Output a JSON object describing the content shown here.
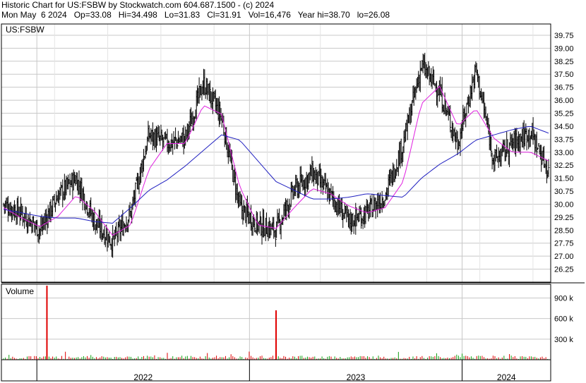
{
  "header": {
    "line1": "Historic Chart for US:FSBW by Stockwatch.com 604.687.1500 - (c) 2024",
    "line2": "Mon May  6 2024   Op=33.08   Hi=34.498   Lo=31.83   Cl=31.91   Vol=16,476   Year hi=38.70   lo=26.08"
  },
  "colors": {
    "price_bars": "#000000",
    "ma_short": "#e020e0",
    "ma_long": "#2020c0",
    "vol_up": "#10a010",
    "vol_down": "#e00000",
    "grid": "#c8c8c8"
  },
  "chart_data": [
    {
      "type": "line",
      "label": "US:FSBW",
      "series_style": "ohlc-bars with two moving averages",
      "y_ticks": [
        "39.75",
        "39.00",
        "38.25",
        "37.50",
        "36.75",
        "36.00",
        "35.25",
        "34.50",
        "33.75",
        "33.00",
        "32.25",
        "31.50",
        "30.75",
        "30.00",
        "29.25",
        "28.50",
        "27.75",
        "27.00",
        "26.25"
      ],
      "ylim": [
        25.5,
        40.4
      ],
      "x_ticks": [
        "2022",
        "2023",
        "2024"
      ],
      "grid": true,
      "series": [
        {
          "name": "",
          "kind": "price",
          "x": [
            "2021-11",
            "2021-12",
            "2022-01",
            "2022-02",
            "2022-03",
            "2022-04",
            "2022-05",
            "2022-06",
            "2022-07",
            "2022-08",
            "2022-09",
            "2022-10",
            "2022-11",
            "2022-12",
            "2023-01",
            "2023-02",
            "2023-03",
            "2023-04",
            "2023-05",
            "2023-06",
            "2023-07",
            "2023-08",
            "2023-09",
            "2023-10",
            "2023-11",
            "2023-12",
            "2024-01",
            "2024-02",
            "2024-03",
            "2024-04",
            "2024-05"
          ],
          "values": [
            30.0,
            29.5,
            28.5,
            30.5,
            31.5,
            29.0,
            27.8,
            29.5,
            34.0,
            33.5,
            33.8,
            37.0,
            35.0,
            29.8,
            28.8,
            28.5,
            30.8,
            31.8,
            30.5,
            29.0,
            29.5,
            30.5,
            33.5,
            38.0,
            36.5,
            33.5,
            37.8,
            32.5,
            33.5,
            34.2,
            31.9
          ]
        },
        {
          "name": "",
          "kind": "ma_short",
          "x": [
            "2021-11",
            "2021-12",
            "2022-01",
            "2022-02",
            "2022-03",
            "2022-04",
            "2022-05",
            "2022-06",
            "2022-07",
            "2022-08",
            "2022-09",
            "2022-10",
            "2022-11",
            "2022-12",
            "2023-01",
            "2023-02",
            "2023-03",
            "2023-04",
            "2023-05",
            "2023-06",
            "2023-07",
            "2023-08",
            "2023-09",
            "2023-10",
            "2023-11",
            "2023-12",
            "2024-01",
            "2024-02",
            "2024-03",
            "2024-04",
            "2024-05"
          ],
          "values": [
            29.8,
            29.2,
            28.7,
            29.3,
            30.5,
            29.6,
            28.2,
            28.8,
            32.0,
            33.5,
            33.5,
            35.7,
            35.2,
            31.0,
            28.8,
            28.6,
            29.8,
            30.9,
            30.6,
            29.9,
            29.5,
            29.8,
            31.3,
            35.8,
            36.8,
            34.5,
            35.5,
            33.8,
            33.0,
            33.0,
            32.5
          ]
        },
        {
          "name": "",
          "kind": "ma_long",
          "x": [
            "2021-11",
            "2021-12",
            "2022-01",
            "2022-02",
            "2022-03",
            "2022-04",
            "2022-05",
            "2022-06",
            "2022-07",
            "2022-08",
            "2022-09",
            "2022-10",
            "2022-11",
            "2022-12",
            "2023-01",
            "2023-02",
            "2023-03",
            "2023-04",
            "2023-05",
            "2023-06",
            "2023-07",
            "2023-08",
            "2023-09",
            "2023-10",
            "2023-11",
            "2023-12",
            "2024-01",
            "2024-02",
            "2024-03",
            "2024-04",
            "2024-05"
          ],
          "values": [
            29.7,
            29.5,
            29.3,
            29.2,
            29.2,
            29.0,
            28.9,
            29.8,
            30.8,
            31.4,
            32.2,
            33.1,
            34.0,
            33.7,
            32.5,
            31.3,
            30.8,
            30.3,
            30.3,
            30.4,
            30.6,
            30.5,
            30.4,
            31.5,
            32.3,
            32.9,
            33.7,
            34.0,
            34.3,
            34.5,
            34.1
          ]
        }
      ]
    },
    {
      "type": "bar",
      "label": "Volume",
      "y_ticks": [
        "900 k",
        "600 k",
        "300 k"
      ],
      "ylim": [
        0,
        1100
      ],
      "unit": "k shares",
      "x_ticks": [
        "2022",
        "2023",
        "2024"
      ],
      "spikes": [
        {
          "x": "2022-01",
          "value": 1080,
          "direction": "down"
        },
        {
          "x": "2023-02",
          "value": 720,
          "direction": "down"
        }
      ],
      "typical_range": [
        10,
        60
      ]
    }
  ]
}
